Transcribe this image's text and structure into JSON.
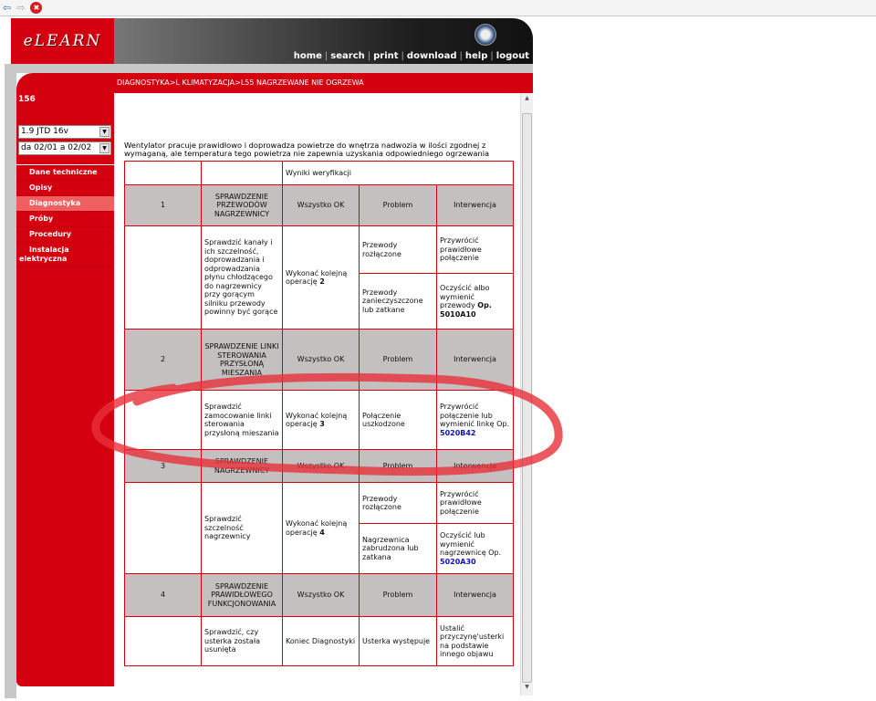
{
  "browser": {
    "back": "⇦",
    "forward": "⇨",
    "stop": "✖"
  },
  "header": {
    "logo": "eLEARN",
    "nav": [
      "home",
      "search",
      "print",
      "download",
      "help",
      "logout"
    ]
  },
  "breadcrumb": "DIAGNOSTYKA>L KLIMATYZACJA>L55 NAGRZEWANE NIE OGRZEWA",
  "sidebar": {
    "model": "156",
    "engine": "1.9 JTD 16v",
    "period": "da 02/01 a 02/02",
    "items": [
      {
        "label": "Dane techniczne"
      },
      {
        "label": "Opisy"
      },
      {
        "label": "Diagnostyka"
      },
      {
        "label": "Próby"
      },
      {
        "label": "Procedury"
      },
      {
        "label": "Instalacja elektryczna"
      }
    ]
  },
  "content": {
    "description": "Wentylator pracuje prawidłowo i doprowadza powietrze do wnętrza nadwozia w ilości zgodnej z wymaganą, ale temperatura tego powietrza nie zapewnia uzyskania odpowiedniego ogrzewania",
    "results_header": "Wyniki weryfikacji",
    "col_ok": "Wszystko OK",
    "col_problem": "Problem",
    "col_intervention": "Interwencja",
    "steps": [
      {
        "num": "1",
        "title": "SPRAWDZENIE PRZEWODÓW NAGRZEWNICY",
        "check": "Sprawdzić kanały i ich szczelność, doprowadzania i odprowadzania płynu chłodzącego do nagrzewnicy przy gorącym silniku przewody powinny być gorące",
        "ok_text": "Wykonać kolejną operację",
        "ok_num": "2",
        "problems": [
          {
            "problem": "Przewody rozłączone",
            "action": "Przywrócić prawidłowe połączenie"
          },
          {
            "problem": "Przewody zanieczyszczone lub zatkane",
            "action": "Oczyścić albo wymienić przewody",
            "op": "Op. 5010A10"
          }
        ]
      },
      {
        "num": "2",
        "title": "SPRAWDZENIE LINKI STEROWANIA PRZYSŁONĄ MIESZANIA",
        "check": "Sprawdzić zamocowanie linki sterowania przysłoną mieszania",
        "ok_text": "Wykonać kolejną operację",
        "ok_num": "3",
        "problems": [
          {
            "problem": "Połączenie uszkodzone",
            "action": "Przywrócić połączenie lub wymienić linkę Op.",
            "link": "5020B42"
          }
        ]
      },
      {
        "num": "3",
        "title": "SPRAWDZENIE NAGRZEWNICY",
        "check": "Sprawdzić szczelność nagrzewnicy",
        "ok_text": "Wykonać kolejną operację",
        "ok_num": "4",
        "problems": [
          {
            "problem": "Przewody rozłączone",
            "action": "Przywrócić prawidłowe połączenie"
          },
          {
            "problem": "Nagrzewnica zabrudzona lub zatkana",
            "action": "Oczyścić lub wymienić nagrzewnicę Op.",
            "link": "5020A30"
          }
        ]
      },
      {
        "num": "4",
        "title": "SPRAWDZENIE PRAWIDŁOWEGO FUNKCJONOWANIA",
        "check": "Sprawdzić, czy usterka została usunięta",
        "ok_text": "Koniec Diagnostyki",
        "ok_num": "",
        "problems": [
          {
            "problem": "Usterka występuje",
            "action": "Ustalić przyczynę'usterki na podstawie innego objawu"
          }
        ]
      }
    ]
  },
  "annotation_color": "#e8303a"
}
